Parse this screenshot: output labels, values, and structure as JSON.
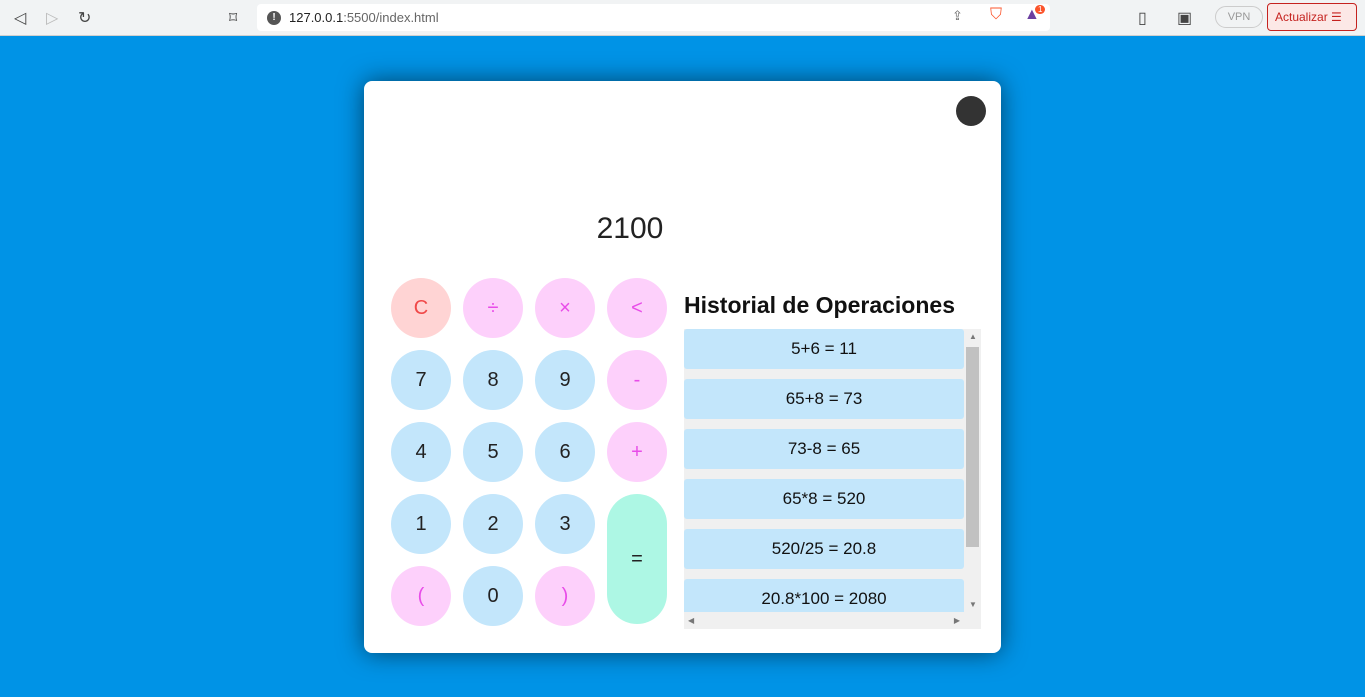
{
  "browser": {
    "url_host": "127.0.0.1",
    "url_path": ":5500/index.html",
    "vpn": "VPN",
    "update": "Actualizar",
    "brave_badge": "1"
  },
  "calculator": {
    "display": "2100",
    "buttons": [
      {
        "label": "C",
        "type": "clr"
      },
      {
        "label": "÷",
        "type": "op"
      },
      {
        "label": "×",
        "type": "op"
      },
      {
        "label": "<",
        "type": "op"
      },
      {
        "label": "7",
        "type": "num"
      },
      {
        "label": "8",
        "type": "num"
      },
      {
        "label": "9",
        "type": "num"
      },
      {
        "label": "-",
        "type": "op"
      },
      {
        "label": "4",
        "type": "num"
      },
      {
        "label": "5",
        "type": "num"
      },
      {
        "label": "6",
        "type": "num"
      },
      {
        "label": "+",
        "type": "op"
      },
      {
        "label": "1",
        "type": "num"
      },
      {
        "label": "2",
        "type": "num"
      },
      {
        "label": "3",
        "type": "num"
      },
      {
        "label": "=",
        "type": "eq"
      },
      {
        "label": "(",
        "type": "op"
      },
      {
        "label": "0",
        "type": "num"
      },
      {
        "label": ")",
        "type": "op"
      }
    ]
  },
  "history": {
    "title": "Historial de Operaciones",
    "items": [
      "5+6 = 11",
      "65+8 = 73",
      "73-8 = 65",
      "65*8 = 520",
      "520/25 = 20.8",
      "20.8*100 = 2080"
    ]
  }
}
